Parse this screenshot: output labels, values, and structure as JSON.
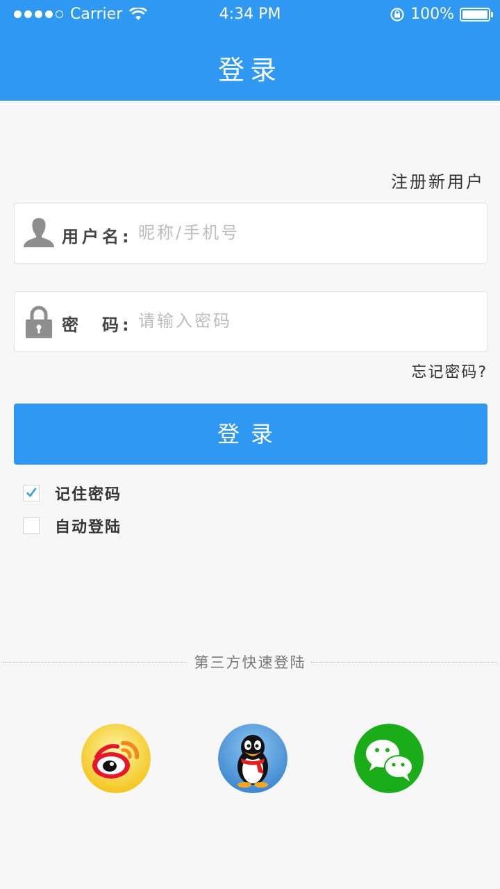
{
  "status_bar": {
    "carrier": "Carrier",
    "time": "4:34 PM",
    "battery_percent": "100%"
  },
  "nav": {
    "title": "登录"
  },
  "register": {
    "label": "注册新用户"
  },
  "username_field": {
    "label": "用户名:",
    "placeholder": "昵称/手机号",
    "icon": "user-icon"
  },
  "password_field": {
    "label": "密　码:",
    "placeholder": "请输入密码",
    "icon": "lock-icon"
  },
  "forgot": {
    "label": "忘记密码?"
  },
  "login_button": {
    "label": "登录"
  },
  "options": [
    {
      "label": "记住密码",
      "checked": true
    },
    {
      "label": "自动登陆",
      "checked": false
    }
  ],
  "third_party": {
    "label": "第三方快速登陆",
    "providers": [
      "weibo-icon",
      "qq-icon",
      "wechat-icon"
    ]
  },
  "colors": {
    "accent": "#2e98f3",
    "background": "#f7f7f7"
  }
}
